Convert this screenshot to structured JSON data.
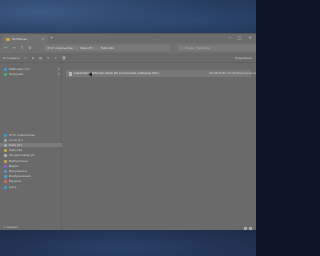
{
  "window": {
    "tab_title": "Ta1fTenee",
    "tab_close": "×",
    "new_tab": "+",
    "controls": {
      "minimize": "–",
      "maximize": "□",
      "close": "×"
    }
  },
  "nav": {
    "back": "←",
    "forward": "→",
    "up": "↑",
    "refresh": "↻"
  },
  "breadcrumb": {
    "items": [
      "Этот компьютер",
      "Data (E:)",
      "Taltoniks"
    ],
    "separator": "›"
  },
  "search": {
    "placeholder": "Поиск: Taltoniks",
    "icon": "search-icon"
  },
  "toolbar": {
    "create_label": "Создать",
    "cut_icon": "cut-icon",
    "copy_icon": "copy-icon",
    "paste_icon": "paste-icon",
    "rename_icon": "rename-icon",
    "share_icon": "share-icon",
    "delete_icon": "delete-icon",
    "details_label": "Подробнее"
  },
  "sidebar": {
    "items": [
      {
        "label": "Рабочий стол",
        "pinned": true,
        "selected": false
      },
      {
        "label": "Загрузки",
        "pinned": true,
        "selected": false
      },
      {
        "label": "Этот компьютер",
        "pinned": false,
        "selected": false
      },
      {
        "label": "Local (C:)",
        "pinned": false,
        "selected": false
      },
      {
        "label": "Data (E:)",
        "pinned": false,
        "selected": true
      },
      {
        "label": "Taltoniks",
        "pinned": false,
        "selected": false
      },
      {
        "label": "CD-дисковод (F:)",
        "pinned": false,
        "selected": false
      },
      {
        "label": "Библиотеки",
        "pinned": false,
        "selected": false
      },
      {
        "label": "Видео",
        "pinned": false,
        "selected": false
      },
      {
        "label": "Документы",
        "pinned": false,
        "selected": false
      },
      {
        "label": "Изображения",
        "pinned": false,
        "selected": false
      },
      {
        "label": "Музыка",
        "pinned": false,
        "selected": false
      },
      {
        "label": "Сеть",
        "pinned": false,
        "selected": false
      }
    ]
  },
  "files": [
    {
      "name": "Installation.Taltoniks.Data.(E).(unlicensed.software).[RC]",
      "date": "30.08.2022 10:21",
      "type": "Приложение"
    }
  ],
  "status": {
    "text": "1 элемент"
  },
  "colors": {
    "folder": "#c9a640",
    "drive": "#3aa0d8",
    "window_bg": "#6a6a6a"
  }
}
